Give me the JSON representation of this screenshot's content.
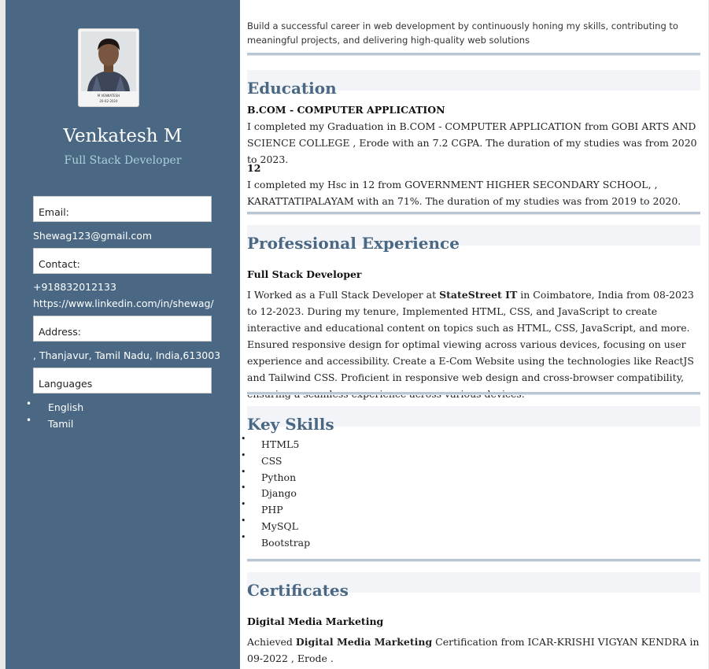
{
  "profile": {
    "name": "Venkatesh M",
    "role": "Full Stack Developer",
    "photo_caption_name": "M VENKATESH",
    "photo_caption_date": "20-02-2024"
  },
  "sidebar": {
    "email_label": "Email:",
    "email_value": "Shewag123@gmail.com",
    "contact_label": "Contact:",
    "phone": "+918832012133",
    "linkedin": "https://www.linkedin.com/in/shewag/",
    "address_label": "Address:",
    "address_value": ", Thanjavur, Tamil Nadu, India,613003",
    "languages_label": "Languages",
    "languages": [
      "English",
      "Tamil"
    ]
  },
  "objective": "Build a successful career in web development by continuously honing my skills, contributing to meaningful projects, and delivering high-quality web solutions",
  "education": {
    "heading": "Education",
    "entries": [
      {
        "degree": "B.COM - COMPUTER APPLICATION",
        "text": "I completed my Graduation in B.COM - COMPUTER APPLICATION from GOBI ARTS AND SCIENCE COLLEGE , Erode with an 7.2 CGPA. The duration of my studies was from 2020 to 2023."
      },
      {
        "degree": "12",
        "text": "I completed my Hsc in 12 from GOVERNMENT HIGHER SECONDARY SCHOOL, , KARATTATIPALAYAM with an 71%. The duration of my studies was from 2019 to 2020."
      }
    ]
  },
  "experience": {
    "heading": "Professional Experience",
    "title": "Full Stack Developer",
    "text_before": "I Worked as a Full Stack Developer at ",
    "company": "StateStreet IT",
    "text_after": " in Coimbatore, India from 08-2023 to 12-2023. During my tenure, Implemented HTML, CSS, and JavaScript to create interactive and educational content on topics such as HTML, CSS, JavaScript, and more. Ensured responsive design for optimal viewing across various devices, focusing on user experience and accessibility. Create a E-Com Website using the technologies like ReactJS and Tailwind CSS. Proficient in responsive web design and cross-browser compatibility, ensuring a seamless experience across various devices."
  },
  "skills": {
    "heading": "Key Skills",
    "items": [
      "HTML5",
      "CSS",
      "Python",
      "Django",
      "PHP",
      "MySQL",
      "Bootstrap"
    ]
  },
  "certificates": {
    "heading": "Certificates",
    "title": "Digital Media Marketing",
    "text_before": "Achieved ",
    "name": "Digital Media Marketing",
    "text_after": " Certification from ICAR-KRISHI VIGYAN KENDRA in 09-2022 , Erode ."
  },
  "colors": {
    "sidebar_bg": "#4a6884",
    "accent": "#4a6884",
    "role_color": "#a9d1d8"
  }
}
